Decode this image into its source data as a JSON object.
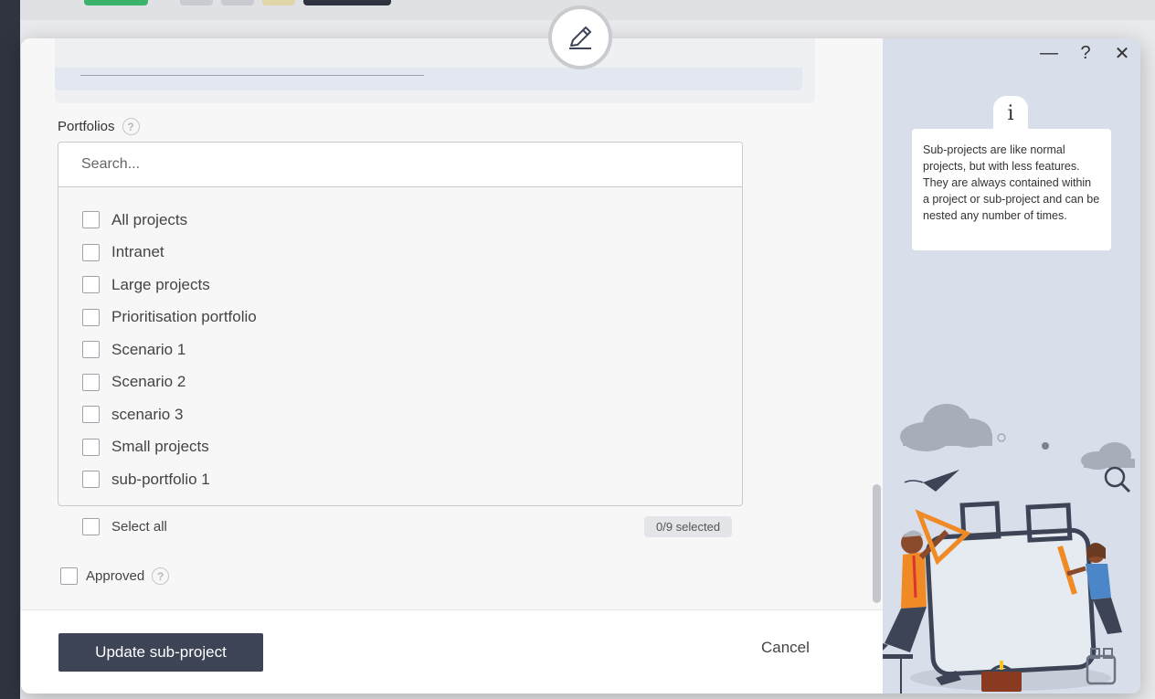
{
  "portfolios": {
    "label": "Portfolios",
    "search_placeholder": "Search...",
    "options": [
      "All projects",
      "Intranet",
      "Large projects",
      "Prioritisation portfolio",
      "Scenario 1",
      "Scenario 2",
      "scenario 3",
      "Small projects",
      "sub-portfolio 1"
    ],
    "select_all_label": "Select all",
    "selected_count": "0/9 selected"
  },
  "approved": {
    "label": "Approved"
  },
  "footer": {
    "update_label": "Update sub-project",
    "cancel_label": "Cancel"
  },
  "help_icon_glyph": "?",
  "info_panel": {
    "controls": {
      "minimize": "—",
      "help": "?",
      "close": "✕"
    },
    "info_glyph": "i",
    "text": "Sub-projects are like normal projects, but with less features. They are always contained within a project or sub-project and can be nested any number of times."
  },
  "colors": {
    "primary_button": "#3d4456",
    "info_panel_bg": "#d8deea",
    "accent_orange": "#f08a24"
  },
  "icons": {
    "edit": "pencil-icon",
    "help": "question-circle-icon",
    "info": "info-icon"
  }
}
